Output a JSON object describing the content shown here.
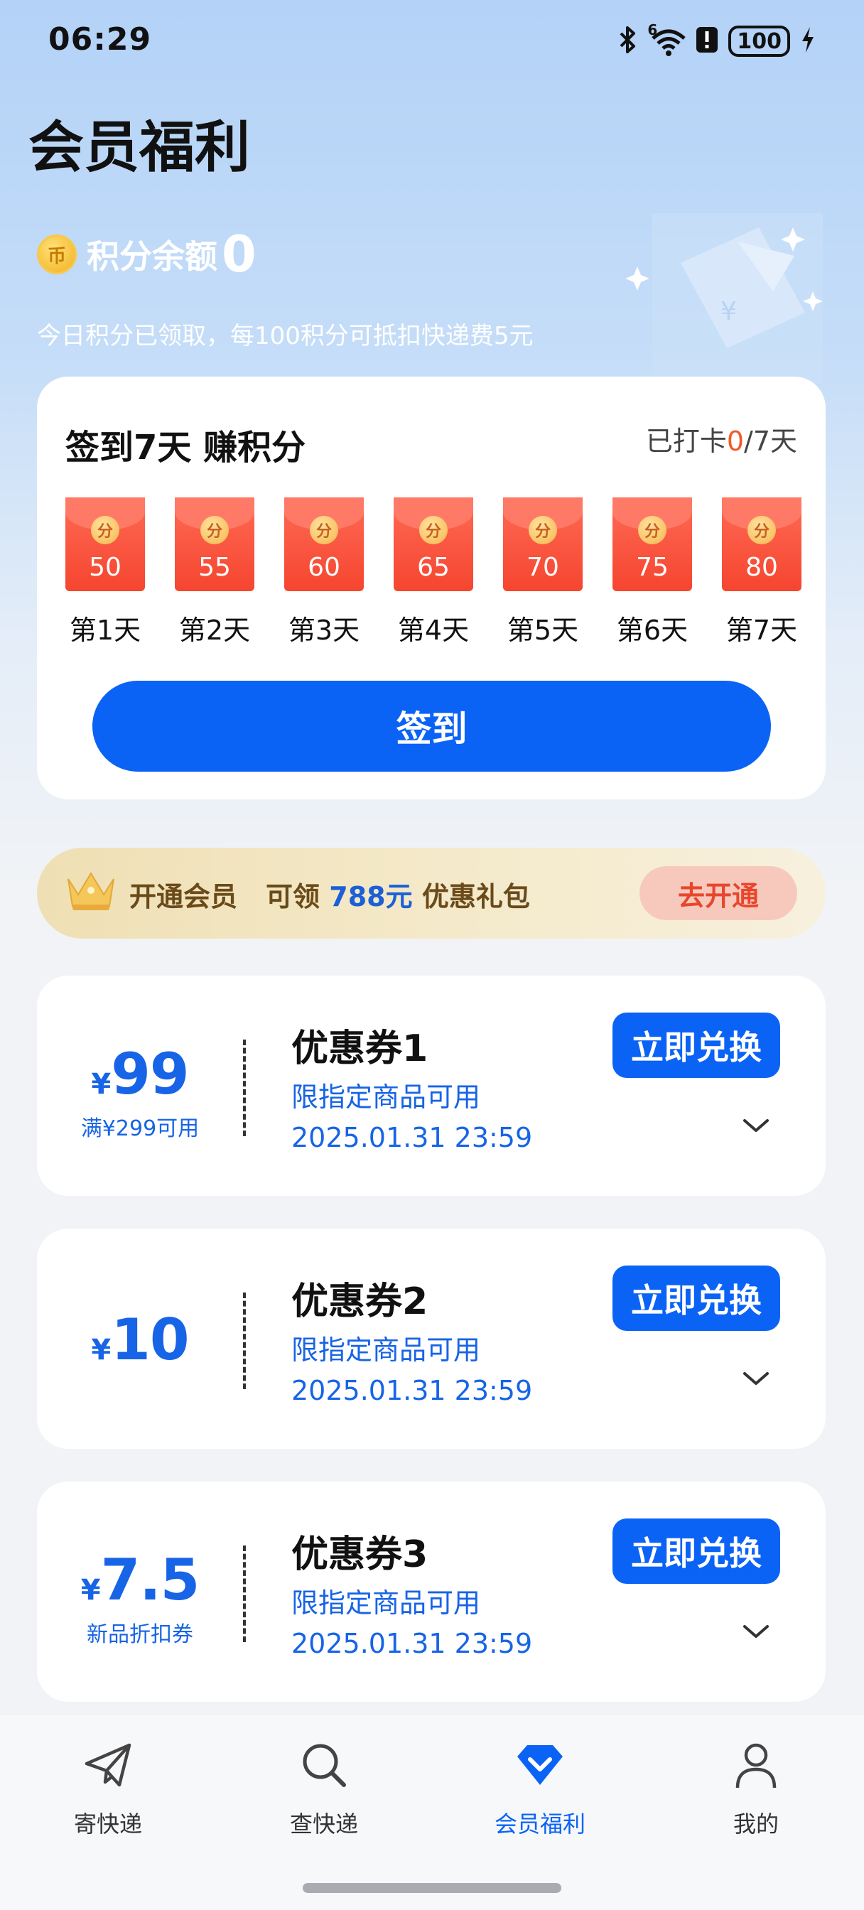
{
  "status_bar": {
    "time": "06:29",
    "signal_superscript": "6",
    "battery": "100"
  },
  "page_title": "会员福利",
  "points": {
    "coin_glyph": "币",
    "label": "积分余额",
    "value": "0",
    "note": "今日积分已领取，每100积分可抵扣快递费5元"
  },
  "checkin": {
    "title": "签到7天 赚积分",
    "progress_prefix": "已打卡",
    "progress_done": "0",
    "progress_total": "/7天",
    "seal_glyph": "分",
    "days": [
      {
        "amount": "50",
        "label": "第1天"
      },
      {
        "amount": "55",
        "label": "第2天"
      },
      {
        "amount": "60",
        "label": "第3天"
      },
      {
        "amount": "65",
        "label": "第4天"
      },
      {
        "amount": "70",
        "label": "第5天"
      },
      {
        "amount": "75",
        "label": "第6天"
      },
      {
        "amount": "80",
        "label": "第7天"
      }
    ],
    "button": "签到"
  },
  "member_banner": {
    "open_label": "开通会员",
    "claim_prefix": "可领",
    "price": "788元",
    "claim_suffix": "优惠礼包",
    "button": "去开通"
  },
  "coupons": [
    {
      "yen": "¥",
      "value": "99",
      "condition": "满¥299可用",
      "name": "优惠券1",
      "scope": "限指定商品可用",
      "expiry": "2025.01.31 23:59",
      "button": "立即兑换"
    },
    {
      "yen": "¥",
      "value": "10",
      "condition": "",
      "name": "优惠券2",
      "scope": "限指定商品可用",
      "expiry": "2025.01.31 23:59",
      "button": "立即兑换"
    },
    {
      "yen": "¥",
      "value": "7.5",
      "condition": "新品折扣券",
      "name": "优惠券3",
      "scope": "限指定商品可用",
      "expiry": "2025.01.31 23:59",
      "button": "立即兑换"
    }
  ],
  "nav": {
    "items": [
      {
        "label": "寄快递",
        "icon": "paper-plane-icon"
      },
      {
        "label": "查快递",
        "icon": "search-icon"
      },
      {
        "label": "会员福利",
        "icon": "member-benefits-icon"
      },
      {
        "label": "我的",
        "icon": "profile-icon"
      }
    ],
    "active_index": 2
  },
  "colors": {
    "accent": "#0b63f6",
    "price_blue": "#1764e6",
    "red_packet": "#f5452f",
    "highlight_orange": "#f05a2a"
  }
}
